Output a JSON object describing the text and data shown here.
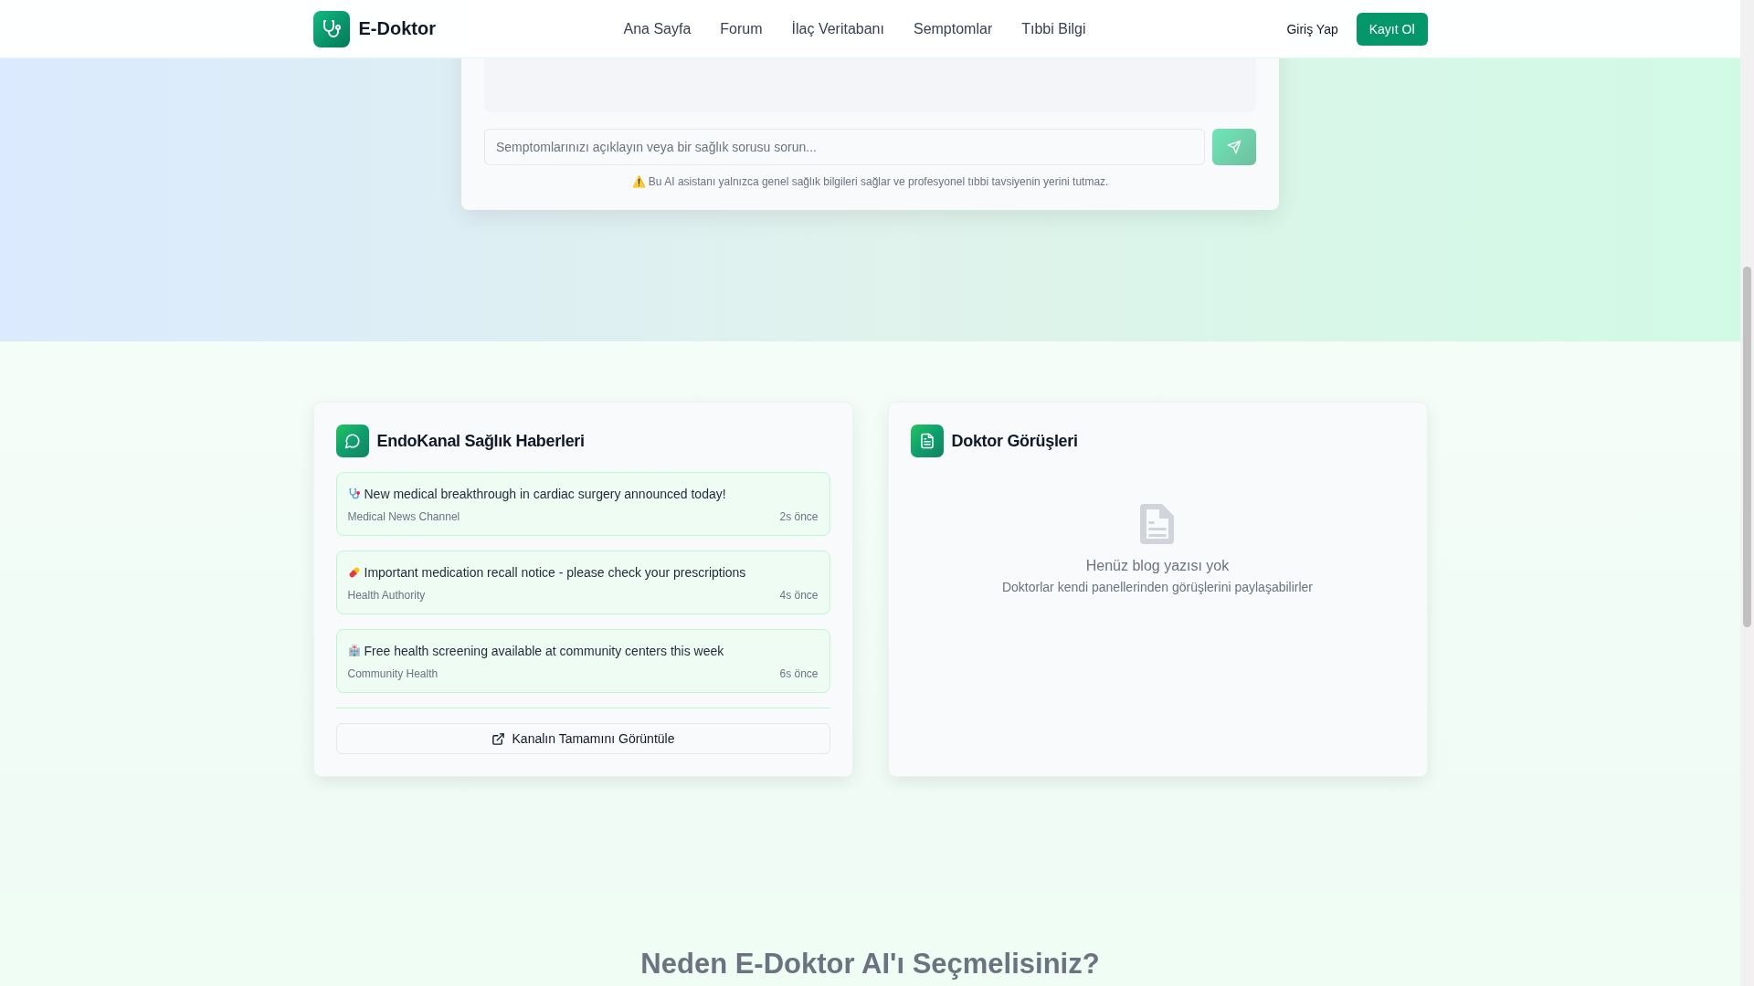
{
  "header": {
    "brand": "E-Doktor",
    "nav": [
      "Ana Sayfa",
      "Forum",
      "İlaç Veritabanı",
      "Semptomlar",
      "Tıbbi Bilgi"
    ],
    "login": "Giriş Yap",
    "signup": "Kayıt Ol"
  },
  "chat": {
    "placeholder": "Semptomlarınızı açıklayın veya bir sağlık sorusu sorun...",
    "disclaimer": "⚠️ Bu AI asistanı yalnızca genel sağlık bilgileri sağlar ve profesyonel tıbbi tavsiyenin yerini tutmaz."
  },
  "news": {
    "title": "EndoKanal Sağlık Haberleri",
    "items": [
      {
        "text": "New medical breakthrough in cardiac surgery announced today!",
        "source": "Medical News Channel",
        "time": "2s önce"
      },
      {
        "text": "Important medication recall notice - please check your prescriptions",
        "source": "Health Authority",
        "time": "4s önce"
      },
      {
        "text": "Free health screening available at community centers this week",
        "source": "Community Health",
        "time": "6s önce"
      }
    ],
    "button": "Kanalın Tamamını Görüntüle"
  },
  "doctors": {
    "title": "Doktor Görüşleri",
    "empty_title": "Henüz blog yazısı yok",
    "empty_text": "Doktorlar kendi panellerinden görüşlerini paylaşabilirler"
  },
  "section_heading": "Neden E-Doktor AI'ı Seçmelisiniz?"
}
